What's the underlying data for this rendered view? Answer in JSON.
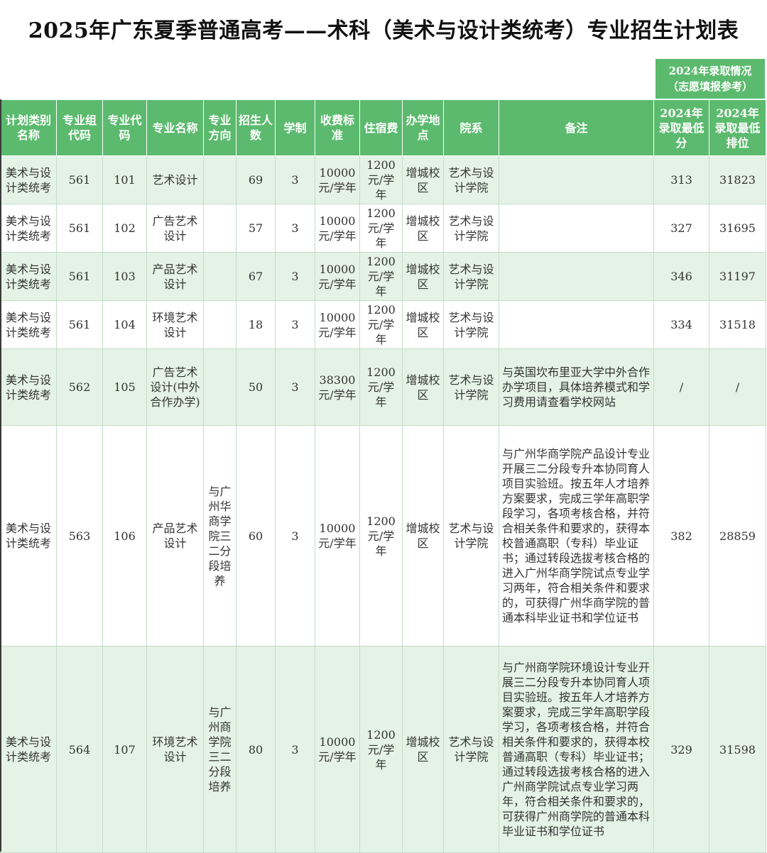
{
  "title": "2025年广东夏季普通高考——术科（美术与设计类统考）专业招生计划表",
  "reference": {
    "line1": "2024年录取情况",
    "line2": "（志愿填报参考）"
  },
  "headers": {
    "category": "计划类别名称",
    "group_code": "专业组代码",
    "major_code": "专业代码",
    "major_name": "专业名称",
    "direction": "专业方向",
    "enroll": "招生人数",
    "years": "学制",
    "fee": "收费标准",
    "dorm": "住宿费",
    "campus": "办学地点",
    "dept": "院系",
    "note": "备注",
    "min_score": "2024年录取最低分",
    "min_rank": "2024年录取最低排位"
  },
  "rows": [
    {
      "category": "美术与设计类统考",
      "group_code": "561",
      "major_code": "101",
      "major_name": "艺术设计",
      "direction": "",
      "enroll": "69",
      "years": "3",
      "fee": "10000元/学年",
      "dorm": "1200元/学年",
      "campus": "增城校区",
      "dept": "艺术与设计学院",
      "note": "",
      "min_score": "313",
      "min_rank": "31823"
    },
    {
      "category": "美术与设计类统考",
      "group_code": "561",
      "major_code": "102",
      "major_name": "广告艺术设计",
      "direction": "",
      "enroll": "57",
      "years": "3",
      "fee": "10000元/学年",
      "dorm": "1200元/学年",
      "campus": "增城校区",
      "dept": "艺术与设计学院",
      "note": "",
      "min_score": "327",
      "min_rank": "31695"
    },
    {
      "category": "美术与设计类统考",
      "group_code": "561",
      "major_code": "103",
      "major_name": "产品艺术设计",
      "direction": "",
      "enroll": "67",
      "years": "3",
      "fee": "10000元/学年",
      "dorm": "1200元/学年",
      "campus": "增城校区",
      "dept": "艺术与设计学院",
      "note": "",
      "min_score": "346",
      "min_rank": "31197"
    },
    {
      "category": "美术与设计类统考",
      "group_code": "561",
      "major_code": "104",
      "major_name": "环境艺术设计",
      "direction": "",
      "enroll": "18",
      "years": "3",
      "fee": "10000元/学年",
      "dorm": "1200元/学年",
      "campus": "增城校区",
      "dept": "艺术与设计学院",
      "note": "",
      "min_score": "334",
      "min_rank": "31518"
    },
    {
      "category": "美术与设计类统考",
      "group_code": "562",
      "major_code": "105",
      "major_name": "广告艺术设计(中外合作办学)",
      "direction": "",
      "enroll": "50",
      "years": "3",
      "fee": "38300元/学年",
      "dorm": "1200元/学年",
      "campus": "增城校区",
      "dept": "艺术与设计学院",
      "note": "与英国坎布里亚大学中外合作办学项目，具体培养模式和学习费用请查看学校网站",
      "min_score": "/",
      "min_rank": "/"
    },
    {
      "category": "美术与设计类统考",
      "group_code": "563",
      "major_code": "106",
      "major_name": "产品艺术设计",
      "direction": "与广州华商学院三二分段培养",
      "enroll": "60",
      "years": "3",
      "fee": "10000元/学年",
      "dorm": "1200元/学年",
      "campus": "增城校区",
      "dept": "艺术与设计学院",
      "note": "与广州华商学院产品设计专业开展三二分段专升本协同育人项目实验班。按五年人才培养方案要求，完成三学年高职学段学习，各项考核合格，并符合相关条件和要求的，获得本校普通高职（专科）毕业证书；通过转段选拔考核合格的进入广州华商学院试点专业学习两年，符合相关条件和要求的，可获得广州华商学院的普通本科毕业证书和学位证书",
      "min_score": "382",
      "min_rank": "28859"
    },
    {
      "category": "美术与设计类统考",
      "group_code": "564",
      "major_code": "107",
      "major_name": "环境艺术设计",
      "direction": "与广州商学院三二分段培养",
      "enroll": "80",
      "years": "3",
      "fee": "10000元/学年",
      "dorm": "1200元/学年",
      "campus": "增城校区",
      "dept": "艺术与设计学院",
      "note": "与广州商学院环境设计专业开展三二分段专升本协同育人项目实验班。按五年人才培养方案要求，完成三学年高职学段学习，各项考核合格，并符合相关条件和要求的，获得本校普通高职（专科）毕业证书；通过转段选拔考核合格的进入广州商学院试点专业学习两年，符合相关条件和要求的，可获得广州商学院的普通本科毕业证书和学位证书",
      "min_score": "329",
      "min_rank": "31598"
    }
  ]
}
